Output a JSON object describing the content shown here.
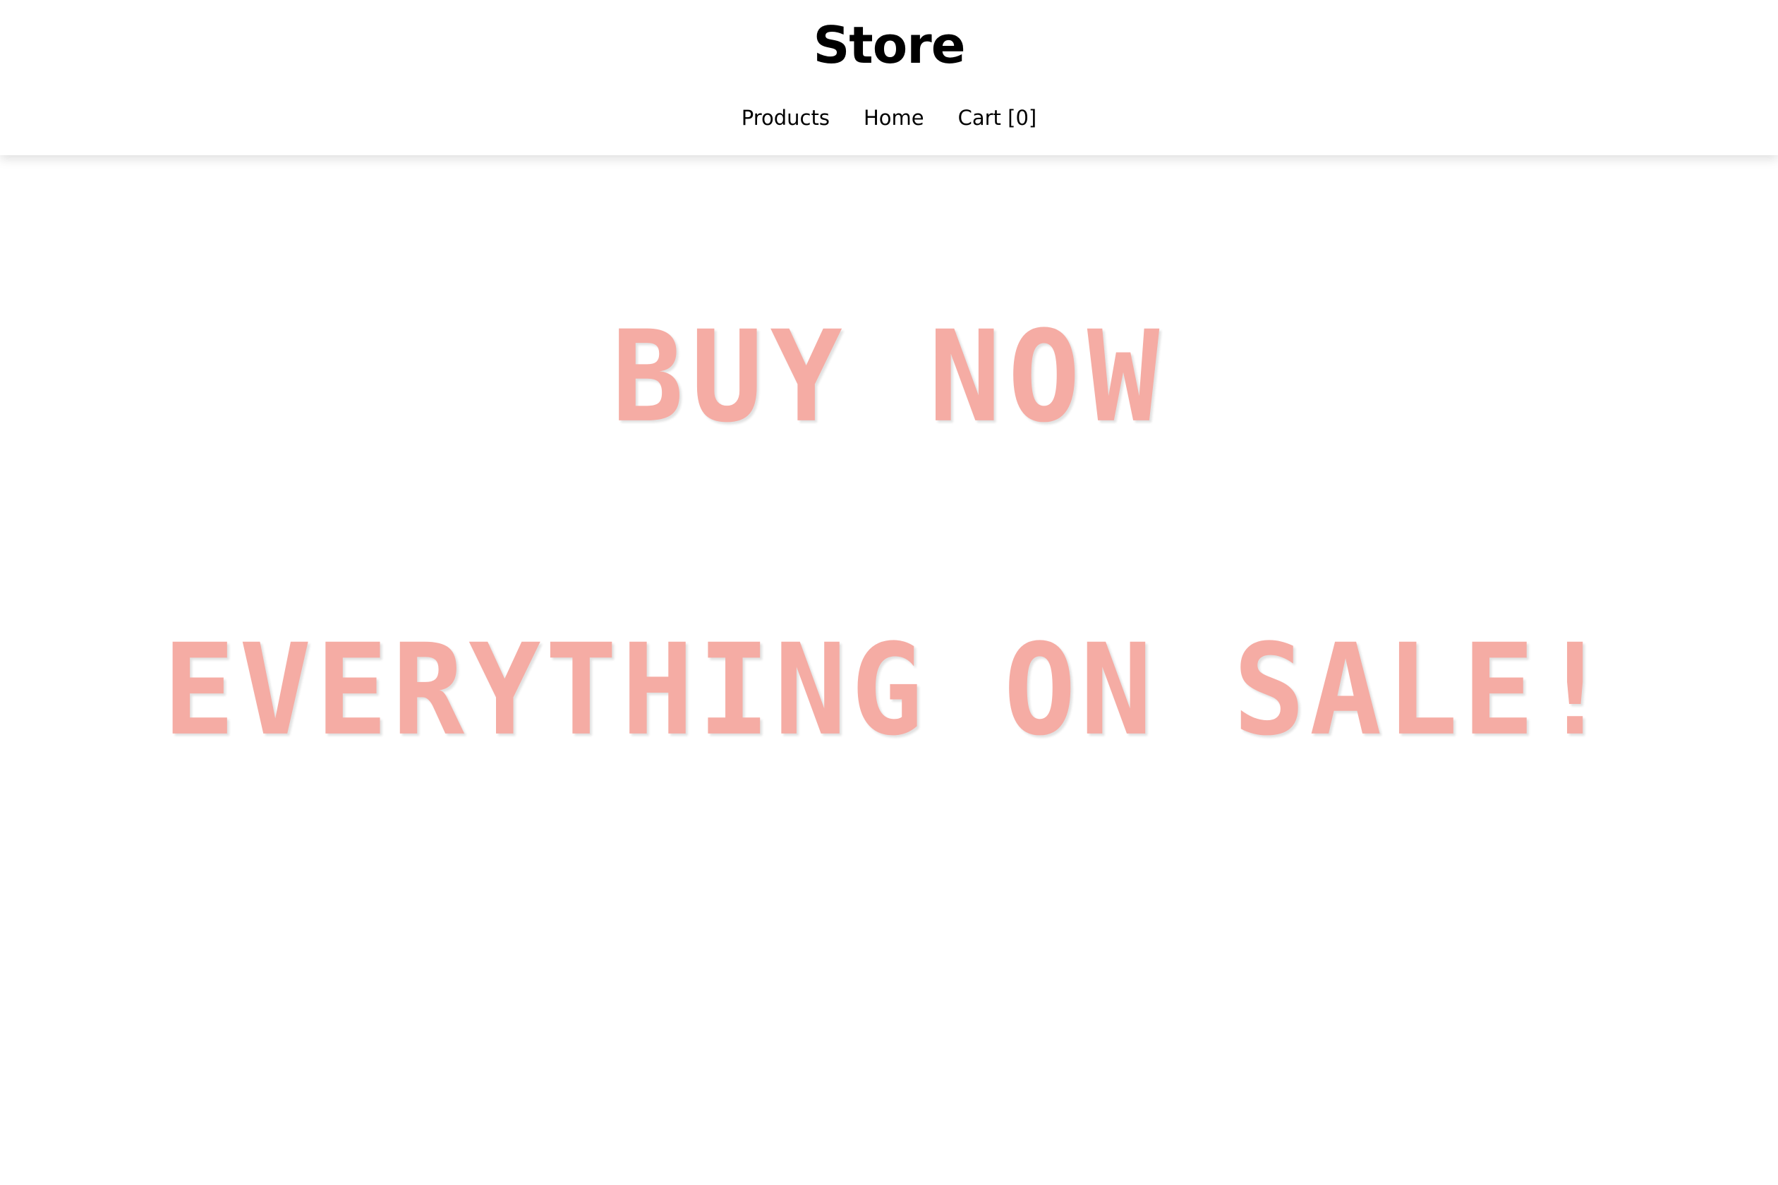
{
  "header": {
    "brand": "Store",
    "nav": {
      "products": "Products",
      "home": "Home",
      "cart": "Cart [0]"
    }
  },
  "hero": {
    "line1": "BUY NOW",
    "line2": "EVERYTHING ON SALE!"
  },
  "colors": {
    "hero_text": "#f5aca4",
    "background": "#ffffff",
    "text": "#000000"
  }
}
